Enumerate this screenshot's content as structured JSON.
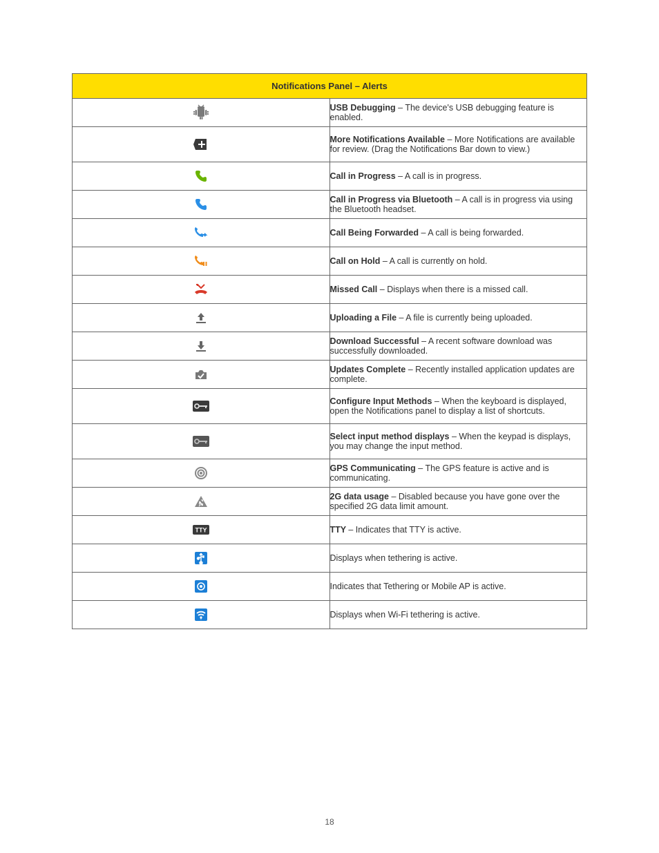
{
  "header": {
    "title_prefix": "Notifications Panel ",
    "title_bold": "– ",
    "title_suffix": "Alerts"
  },
  "rows": [
    {
      "icon": "android-debug-icon",
      "parts": [
        "USB Debugging ",
        "– ",
        "The device's USB debugging feature is enabled."
      ]
    },
    {
      "icon": "more-notifications-icon",
      "parts": [
        "More Notifications Available ",
        "– ",
        "More Notifications are available for review. (Drag the Notifications Bar down to view.)"
      ],
      "tall": true
    },
    {
      "icon": "call-green-icon",
      "parts": [
        "Call in Progress ",
        "– ",
        "A call is in progress."
      ]
    },
    {
      "icon": "call-blue-icon",
      "parts": [
        "Call in Progress via Bluetooth ",
        "– ",
        "A call is in progress via using the Bluetooth headset."
      ]
    },
    {
      "icon": "call-forward-icon",
      "parts": [
        "Call Being Forwarded ",
        "– ",
        "A call is being forwarded."
      ]
    },
    {
      "icon": "call-hold-icon",
      "parts": [
        "Call on Hold ",
        "– ",
        "A call is currently on hold."
      ]
    },
    {
      "icon": "missed-call-icon",
      "parts": [
        "Missed Call ",
        "– ",
        "Displays when there is a missed call."
      ]
    },
    {
      "icon": "upload-icon",
      "parts": [
        "Uploading a File ",
        "– ",
        "A file is currently being uploaded."
      ]
    },
    {
      "icon": "download-icon",
      "parts": [
        "Download Successful ",
        "– ",
        "A recent software download was successfully downloaded."
      ]
    },
    {
      "icon": "updates-complete-icon",
      "parts": [
        "Updates Complete ",
        "– ",
        "Recently installed application updates are complete."
      ]
    },
    {
      "icon": "vpn-connected-icon",
      "parts": [
        "Configure Input Methods ",
        "– ",
        "When the keyboard is displayed, open the Notifications panel to display a list of shortcuts."
      ],
      "tall": true
    },
    {
      "icon": "vpn-disconnected-icon",
      "parts": [
        "Select input method displays ",
        "– ",
        "When the keypad is displays, you may change the input method."
      ],
      "tall": true
    },
    {
      "icon": "gps-active-icon",
      "parts": [
        "GPS Communicating ",
        "– ",
        "The GPS feature is active and is communicating."
      ]
    },
    {
      "icon": "data-limit-icon",
      "parts": [
        "2G data usage ",
        "– ",
        "Disabled because you have gone over the specified 2G data limit amount."
      ]
    },
    {
      "icon": "tty-icon",
      "parts": [
        "TTY ",
        "– ",
        "Indicates that TTY is active."
      ]
    },
    {
      "icon": "usb-tether-icon",
      "parts": [
        "Displays when tethering is active."
      ]
    },
    {
      "icon": "hotspot-active-icon",
      "parts": [
        "Indicates that Tethering or Mobile AP is active."
      ]
    },
    {
      "icon": "wifi-tether-icon",
      "parts": [
        "Displays when Wi-Fi tethering is active."
      ]
    }
  ],
  "page_number": "18"
}
